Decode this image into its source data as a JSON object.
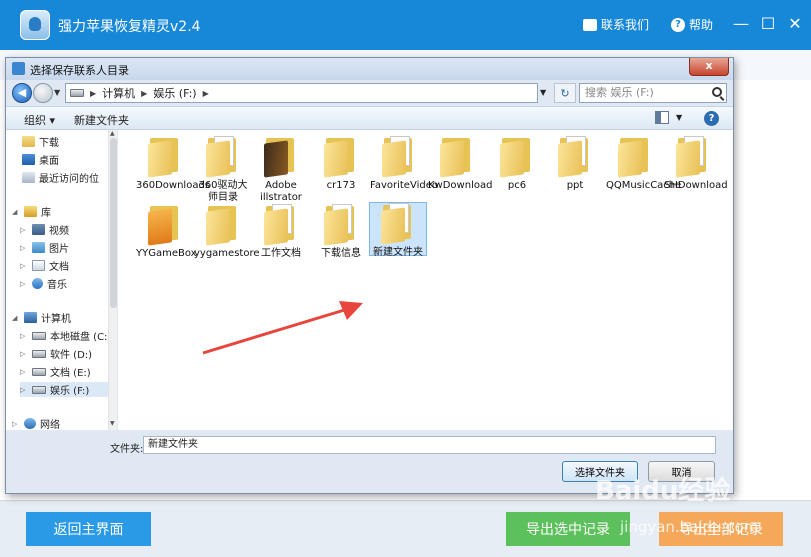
{
  "app": {
    "title": "强力苹果恢复精灵v2.4",
    "contact": "联系我们",
    "help": "帮助",
    "minimize": "—",
    "maximize": "☐",
    "close": "✕",
    "back_button": "返回主界面",
    "export_selected": "导出选中记录",
    "export_all": "导出全部记录"
  },
  "dialog": {
    "title": "选择保存联系人目录",
    "close": "x",
    "breadcrumb": [
      "计算机",
      "娱乐 (F:)"
    ],
    "search_placeholder": "搜索 娱乐 (F:)",
    "toolbar": {
      "organize": "组织 ▾",
      "new_folder": "新建文件夹"
    },
    "nav": [
      {
        "label": "下载"
      },
      {
        "label": "桌面"
      },
      {
        "label": "最近访问的位"
      },
      {
        "label": "库"
      },
      {
        "label": "视频"
      },
      {
        "label": "图片"
      },
      {
        "label": "文档"
      },
      {
        "label": "音乐"
      },
      {
        "label": "计算机"
      },
      {
        "label": "本地磁盘 (C:)"
      },
      {
        "label": "软件 (D:)"
      },
      {
        "label": "文档 (E:)"
      },
      {
        "label": "娱乐 (F:)"
      },
      {
        "label": "网络"
      }
    ],
    "files": [
      {
        "name": "360Downloads"
      },
      {
        "name": "360驱动大师目录"
      },
      {
        "name": "Adobe illstrator"
      },
      {
        "name": "cr173"
      },
      {
        "name": "FavoriteVideo"
      },
      {
        "name": "KwDownload"
      },
      {
        "name": "pc6"
      },
      {
        "name": "ppt"
      },
      {
        "name": "QQMusicCache"
      },
      {
        "name": "SHDownload"
      },
      {
        "name": "YYGameBox"
      },
      {
        "name": "yygamestore"
      },
      {
        "name": "工作文档"
      },
      {
        "name": "下载信息"
      },
      {
        "name": "新建文件夹"
      }
    ],
    "folder_label": "文件夹:",
    "folder_value": "新建文件夹",
    "select_button": "选择文件夹",
    "cancel_button": "取消"
  },
  "watermark": {
    "text": "Baidu经验",
    "sub": "jingyan.baidu.com"
  }
}
